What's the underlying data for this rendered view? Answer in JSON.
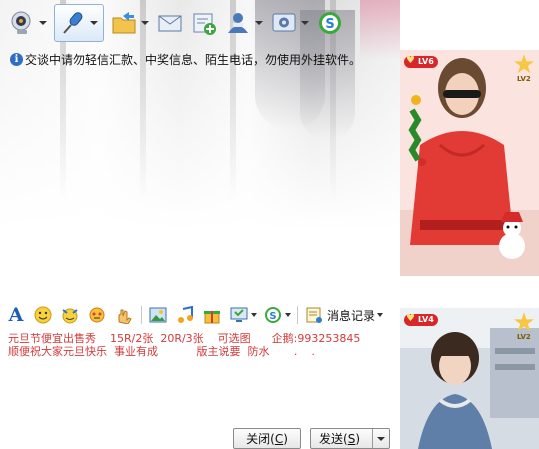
{
  "toolbar": {
    "icons": [
      "webcam-icon",
      "microphone-icon",
      "folder-send-icon",
      "mail-icon",
      "add-card-icon",
      "person-info-icon",
      "settings-icon",
      "s-app-icon"
    ],
    "selected_icon": "microphone-icon"
  },
  "notice": {
    "icon": "info-icon",
    "info_glyph": "i",
    "text": "交谈中请勿轻信汇款、中奖信息、陌生电话，勿使用外挂软件。"
  },
  "panels": {
    "top": {
      "level": "LV6",
      "star_label": "LV2"
    },
    "bottom": {
      "level": "LV4",
      "star_label": "LV2"
    }
  },
  "compose": {
    "font_glyph": "A",
    "icons": [
      "font-icon",
      "smiley-icon",
      "wink-icon",
      "sticker-icon",
      "hand-icon",
      "image-icon",
      "music-icon",
      "gift-icon",
      "screenshot-icon",
      "s-app-icon",
      "message-log-icon"
    ],
    "message_log_label": "消息记录",
    "message_text": "元旦节便宜出售秀    15R/2张  20R/3张    可选图      企鹅:993253845\n顺便祝大家元旦快乐  事业有成           版主说要  防水       .    ."
  },
  "buttons": {
    "close_label": "关闭",
    "close_key": "C",
    "send_label": "发送",
    "send_key": "S"
  },
  "colors": {
    "accent_blue": "#2f6fc2",
    "message_red": "#d23b3b",
    "badge_red": "#d7272b",
    "star_gold": "#f6c842"
  }
}
